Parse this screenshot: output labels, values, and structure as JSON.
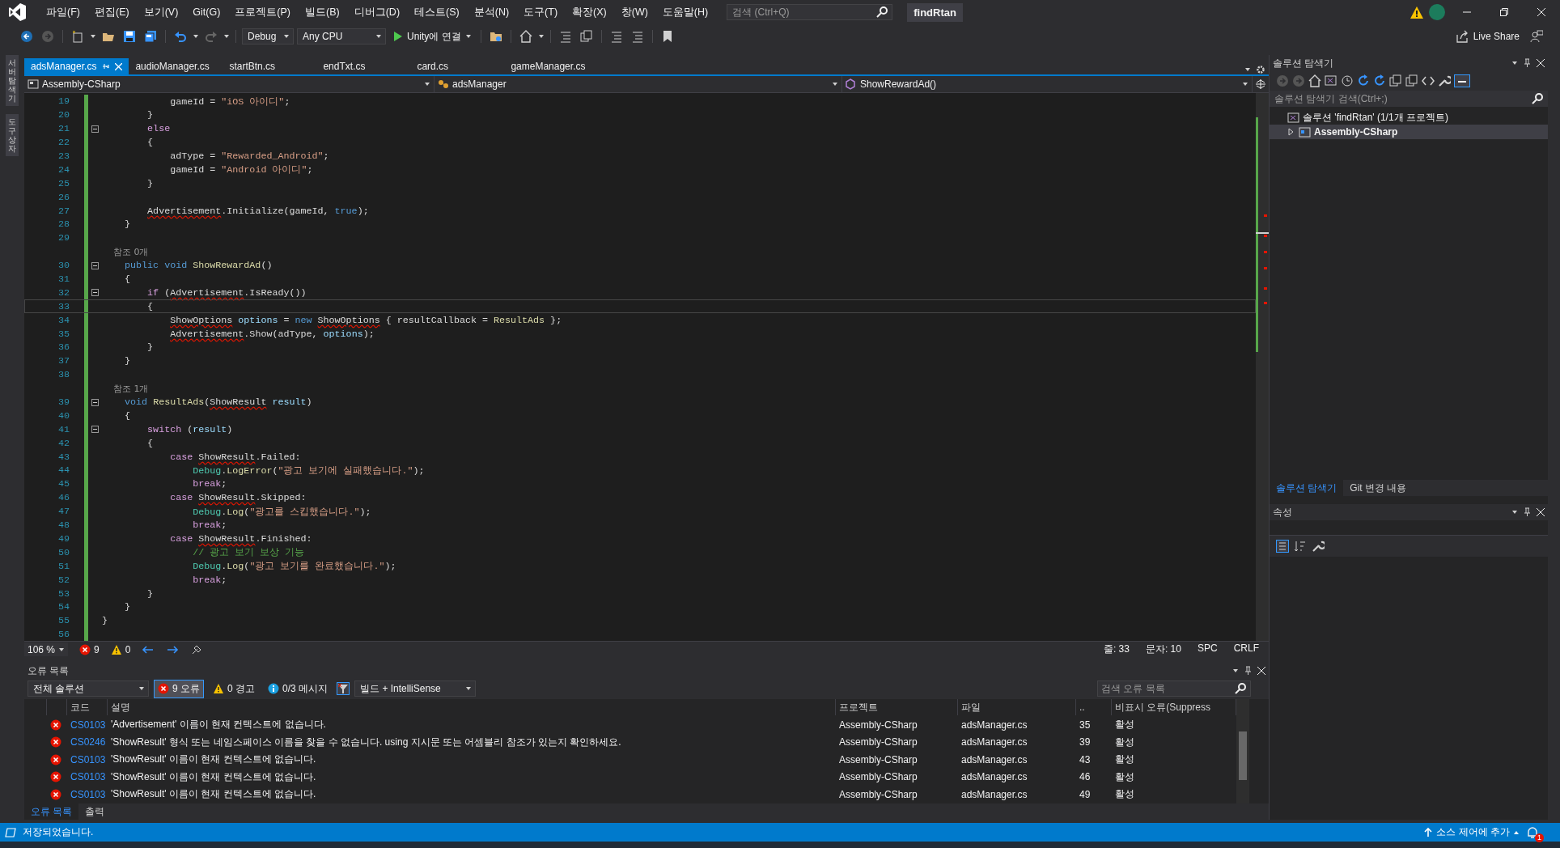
{
  "title_bar": {
    "menu": [
      "파일(F)",
      "편집(E)",
      "보기(V)",
      "Git(G)",
      "프로젝트(P)",
      "빌드(B)",
      "디버그(D)",
      "테스트(S)",
      "분석(N)",
      "도구(T)",
      "확장(X)",
      "창(W)",
      "도움말(H)"
    ],
    "search": {
      "placeholder": "검색 (Ctrl+Q)"
    },
    "solution_name": "findRtan"
  },
  "toolbar": {
    "configuration": "Debug",
    "platform": "Any CPU",
    "run_target": "Unity에 연결",
    "live_share": "Live Share"
  },
  "side_tabs": [
    "서버 탐색기",
    "도구 상자"
  ],
  "document_tabs": [
    {
      "label": "adsManager.cs",
      "selected": true
    },
    {
      "label": "audioManager.cs",
      "selected": false
    },
    {
      "label": "startBtn.cs",
      "selected": false
    },
    {
      "label": "endTxt.cs",
      "selected": false
    },
    {
      "label": "card.cs",
      "selected": false
    },
    {
      "label": "gameManager.cs",
      "selected": false
    }
  ],
  "nav_bar": {
    "project": "Assembly-CSharp",
    "class": "adsManager",
    "member": "ShowRewardAd()"
  },
  "code": {
    "lines": [
      {
        "kind": "code",
        "number": "19",
        "foldable": false,
        "current": false,
        "segments": [
          {
            "kind": "plain",
            "text": "            gameId = "
          },
          {
            "kind": "str",
            "text": "\"iOS 아이디\""
          },
          {
            "kind": "plain",
            "text": ";"
          }
        ]
      },
      {
        "kind": "code",
        "number": "20",
        "foldable": false,
        "current": false,
        "segments": [
          {
            "kind": "plain",
            "text": "        }"
          }
        ]
      },
      {
        "kind": "code",
        "number": "21",
        "foldable": true,
        "current": false,
        "segments": [
          {
            "kind": "ctrl",
            "text": "        else"
          }
        ]
      },
      {
        "kind": "code",
        "number": "22",
        "foldable": false,
        "current": false,
        "segments": [
          {
            "kind": "plain",
            "text": "        {"
          }
        ]
      },
      {
        "kind": "code",
        "number": "23",
        "foldable": false,
        "current": false,
        "segments": [
          {
            "kind": "plain",
            "text": "            adType = "
          },
          {
            "kind": "str",
            "text": "\"Rewarded_Android\""
          },
          {
            "kind": "plain",
            "text": ";"
          }
        ]
      },
      {
        "kind": "code",
        "number": "24",
        "foldable": false,
        "current": false,
        "segments": [
          {
            "kind": "plain",
            "text": "            gameId = "
          },
          {
            "kind": "str",
            "text": "\"Android 아이디\""
          },
          {
            "kind": "plain",
            "text": ";"
          }
        ]
      },
      {
        "kind": "code",
        "number": "25",
        "foldable": false,
        "current": false,
        "segments": [
          {
            "kind": "plain",
            "text": "        }"
          }
        ]
      },
      {
        "kind": "code",
        "number": "26",
        "foldable": false,
        "current": false
      },
      {
        "kind": "code",
        "number": "27",
        "foldable": false,
        "current": false,
        "segments": [
          {
            "kind": "err",
            "text": "        Advertisement"
          },
          {
            "kind": "plain",
            "text": ".Initialize(gameId, "
          },
          {
            "kind": "kw",
            "text": "true"
          },
          {
            "kind": "plain",
            "text": ");"
          }
        ]
      },
      {
        "kind": "code",
        "number": "28",
        "foldable": false,
        "current": false,
        "segments": [
          {
            "kind": "plain",
            "text": "    }"
          }
        ]
      },
      {
        "kind": "code",
        "number": "29",
        "foldable": false,
        "current": false
      },
      {
        "kind": "lens",
        "text": "    참조 0개"
      },
      {
        "kind": "code",
        "number": "30",
        "foldable": true,
        "current": false,
        "segments": [
          {
            "kind": "kw",
            "text": "    public void "
          },
          {
            "kind": "method",
            "text": "ShowRewardAd"
          },
          {
            "kind": "plain",
            "text": "()"
          }
        ]
      },
      {
        "kind": "code",
        "number": "31",
        "foldable": false,
        "current": false,
        "segments": [
          {
            "kind": "plain",
            "text": "    {"
          }
        ]
      },
      {
        "kind": "code",
        "number": "32",
        "foldable": true,
        "current": false,
        "segments": [
          {
            "kind": "ctrl",
            "text": "        if"
          },
          {
            "kind": "plain",
            "text": " ("
          },
          {
            "kind": "err",
            "text": "Advertisement"
          },
          {
            "kind": "plain",
            "text": ".IsReady())"
          }
        ]
      },
      {
        "kind": "code",
        "number": "33",
        "foldable": false,
        "current": true,
        "segments": [
          {
            "kind": "plain",
            "text": "        {"
          }
        ]
      },
      {
        "kind": "code",
        "number": "34",
        "foldable": false,
        "current": false,
        "segments": [
          {
            "kind": "err",
            "text": "            ShowOptions"
          },
          {
            "kind": "param",
            "text": " options"
          },
          {
            "kind": "plain",
            "text": " = "
          },
          {
            "kind": "kw",
            "text": "new "
          },
          {
            "kind": "err",
            "text": "ShowOptions"
          },
          {
            "kind": "plain",
            "text": " { resultCallback = "
          },
          {
            "kind": "method",
            "text": "ResultAds"
          },
          {
            "kind": "plain",
            "text": " };"
          }
        ]
      },
      {
        "kind": "code",
        "number": "35",
        "foldable": false,
        "current": false,
        "segments": [
          {
            "kind": "err",
            "text": "            Advertisement"
          },
          {
            "kind": "plain",
            "text": ".Show(adType, "
          },
          {
            "kind": "param",
            "text": "options"
          },
          {
            "kind": "plain",
            "text": ");"
          }
        ]
      },
      {
        "kind": "code",
        "number": "36",
        "foldable": false,
        "current": false,
        "segments": [
          {
            "kind": "plain",
            "text": "        }"
          }
        ]
      },
      {
        "kind": "code",
        "number": "37",
        "foldable": false,
        "current": false,
        "segments": [
          {
            "kind": "plain",
            "text": "    }"
          }
        ]
      },
      {
        "kind": "code",
        "number": "38",
        "foldable": false,
        "current": false
      },
      {
        "kind": "lens",
        "text": "    참조 1개"
      },
      {
        "kind": "code",
        "number": "39",
        "foldable": true,
        "current": false,
        "segments": [
          {
            "kind": "kw",
            "text": "    void "
          },
          {
            "kind": "method",
            "text": "ResultAds"
          },
          {
            "kind": "plain",
            "text": "("
          },
          {
            "kind": "err",
            "text": "ShowResult"
          },
          {
            "kind": "param",
            "text": " result"
          },
          {
            "kind": "plain",
            "text": ")"
          }
        ]
      },
      {
        "kind": "code",
        "number": "40",
        "foldable": false,
        "current": false,
        "segments": [
          {
            "kind": "plain",
            "text": "    {"
          }
        ]
      },
      {
        "kind": "code",
        "number": "41",
        "foldable": true,
        "current": false,
        "segments": [
          {
            "kind": "ctrl",
            "text": "        switch"
          },
          {
            "kind": "plain",
            "text": " ("
          },
          {
            "kind": "param",
            "text": "result"
          },
          {
            "kind": "plain",
            "text": ")"
          }
        ]
      },
      {
        "kind": "code",
        "number": "42",
        "foldable": false,
        "current": false,
        "segments": [
          {
            "kind": "plain",
            "text": "        {"
          }
        ]
      },
      {
        "kind": "code",
        "number": "43",
        "foldable": false,
        "current": false,
        "segments": [
          {
            "kind": "ctrl",
            "text": "            case "
          },
          {
            "kind": "err",
            "text": "ShowResult"
          },
          {
            "kind": "plain",
            "text": ".Failed:"
          }
        ]
      },
      {
        "kind": "code",
        "number": "44",
        "foldable": false,
        "current": false,
        "segments": [
          {
            "kind": "type",
            "text": "                Debug"
          },
          {
            "kind": "plain",
            "text": "."
          },
          {
            "kind": "method",
            "text": "LogError"
          },
          {
            "kind": "plain",
            "text": "("
          },
          {
            "kind": "str",
            "text": "\"광고 보기에 실패했습니다.\""
          },
          {
            "kind": "plain",
            "text": ");"
          }
        ]
      },
      {
        "kind": "code",
        "number": "45",
        "foldable": false,
        "current": false,
        "segments": [
          {
            "kind": "ctrl",
            "text": "                break"
          },
          {
            "kind": "plain",
            "text": ";"
          }
        ]
      },
      {
        "kind": "code",
        "number": "46",
        "foldable": false,
        "current": false,
        "segments": [
          {
            "kind": "ctrl",
            "text": "            case "
          },
          {
            "kind": "err",
            "text": "ShowResult"
          },
          {
            "kind": "plain",
            "text": ".Skipped:"
          }
        ]
      },
      {
        "kind": "code",
        "number": "47",
        "foldable": false,
        "current": false,
        "segments": [
          {
            "kind": "type",
            "text": "                Debug"
          },
          {
            "kind": "plain",
            "text": "."
          },
          {
            "kind": "method",
            "text": "Log"
          },
          {
            "kind": "plain",
            "text": "("
          },
          {
            "kind": "str",
            "text": "\"광고를 스킵했습니다.\""
          },
          {
            "kind": "plain",
            "text": ");"
          }
        ]
      },
      {
        "kind": "code",
        "number": "48",
        "foldable": false,
        "current": false,
        "segments": [
          {
            "kind": "ctrl",
            "text": "                break"
          },
          {
            "kind": "plain",
            "text": ";"
          }
        ]
      },
      {
        "kind": "code",
        "number": "49",
        "foldable": false,
        "current": false,
        "segments": [
          {
            "kind": "ctrl",
            "text": "            case "
          },
          {
            "kind": "err",
            "text": "ShowResult"
          },
          {
            "kind": "plain",
            "text": ".Finished:"
          }
        ]
      },
      {
        "kind": "code",
        "number": "50",
        "foldable": false,
        "current": false,
        "segments": [
          {
            "kind": "comment",
            "text": "                // 광고 보기 보상 기능"
          }
        ]
      },
      {
        "kind": "code",
        "number": "51",
        "foldable": false,
        "current": false,
        "segments": [
          {
            "kind": "type",
            "text": "                Debug"
          },
          {
            "kind": "plain",
            "text": "."
          },
          {
            "kind": "method",
            "text": "Log"
          },
          {
            "kind": "plain",
            "text": "("
          },
          {
            "kind": "str",
            "text": "\"광고 보기를 완료했습니다.\""
          },
          {
            "kind": "plain",
            "text": ");"
          }
        ]
      },
      {
        "kind": "code",
        "number": "52",
        "foldable": false,
        "current": false,
        "segments": [
          {
            "kind": "ctrl",
            "text": "                break"
          },
          {
            "kind": "plain",
            "text": ";"
          }
        ]
      },
      {
        "kind": "code",
        "number": "53",
        "foldable": false,
        "current": false,
        "segments": [
          {
            "kind": "plain",
            "text": "        }"
          }
        ]
      },
      {
        "kind": "code",
        "number": "54",
        "foldable": false,
        "current": false,
        "segments": [
          {
            "kind": "plain",
            "text": "    }"
          }
        ]
      },
      {
        "kind": "code",
        "number": "55",
        "foldable": false,
        "current": false,
        "segments": [
          {
            "kind": "plain",
            "text": "}"
          }
        ]
      },
      {
        "kind": "code",
        "number": "56",
        "foldable": false,
        "current": false
      }
    ]
  },
  "editor_status": {
    "zoom": "106 %",
    "errors": "9",
    "warnings": "0",
    "line": "줄: 33",
    "column": "문자: 10",
    "whitespace": "SPC",
    "line_ending": "CRLF"
  },
  "error_list": {
    "title": "오류 목록",
    "scope": "전체 솔루션",
    "filters": [
      {
        "kind": "error",
        "label": "9 오류",
        "selected": true
      },
      {
        "kind": "warning",
        "label": "0 경고",
        "selected": false
      },
      {
        "kind": "message",
        "label": "0/3 메시지",
        "selected": false
      }
    ],
    "source": "빌드 + IntelliSense",
    "search": {
      "placeholder": "검색 오류 목록"
    },
    "columns": [
      "코드",
      "설명",
      "프로젝트",
      "파일",
      "..",
      "비표시 오류(Suppress"
    ],
    "rows": [
      {
        "code": "CS0103",
        "description": "'Advertisement' 이름이 현재 컨텍스트에 없습니다.",
        "project": "Assembly-CSharp",
        "file": "adsManager.cs",
        "line": "35",
        "suppression": "활성"
      },
      {
        "code": "CS0246",
        "description": "'ShowResult' 형식 또는 네임스페이스 이름을 찾을 수 없습니다. using 지시문 또는 어셈블리 참조가 있는지 확인하세요.",
        "project": "Assembly-CSharp",
        "file": "adsManager.cs",
        "line": "39",
        "suppression": "활성"
      },
      {
        "code": "CS0103",
        "description": "'ShowResult' 이름이 현재 컨텍스트에 없습니다.",
        "project": "Assembly-CSharp",
        "file": "adsManager.cs",
        "line": "43",
        "suppression": "활성"
      },
      {
        "code": "CS0103",
        "description": "'ShowResult' 이름이 현재 컨텍스트에 없습니다.",
        "project": "Assembly-CSharp",
        "file": "adsManager.cs",
        "line": "46",
        "suppression": "활성"
      },
      {
        "code": "CS0103",
        "description": "'ShowResult' 이름이 현재 컨텍스트에 없습니다.",
        "project": "Assembly-CSharp",
        "file": "adsManager.cs",
        "line": "49",
        "suppression": "활성"
      }
    ],
    "tabs": [
      {
        "label": "오류 목록",
        "selected": true
      },
      {
        "label": "출력",
        "selected": false
      }
    ]
  },
  "solution_explorer": {
    "title": "솔루션 탐색기",
    "search": {
      "placeholder": "솔루션 탐색기 검색(Ctrl+;)"
    },
    "tree": [
      {
        "label": "솔루션 'findRtan' (1/1개 프로젝트)",
        "kind": "solution",
        "selected": false,
        "children": [
          {
            "label": "Assembly-CSharp",
            "kind": "project",
            "expanded": false,
            "selected": true
          }
        ]
      }
    ],
    "tabs": [
      {
        "label": "솔루션 탐색기",
        "selected": true
      },
      {
        "label": "Git 변경 내용",
        "selected": false
      }
    ]
  },
  "properties": {
    "title": "속성"
  },
  "status_bar": {
    "message": "저장되었습니다.",
    "source_control": "소스 제어에 추가",
    "notifications": "1"
  }
}
